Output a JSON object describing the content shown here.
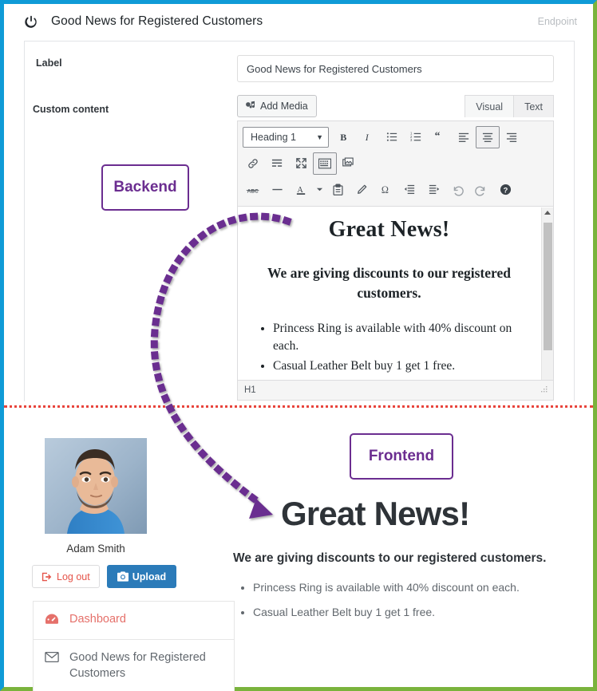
{
  "window": {
    "border_top_left_color": "#0f9bd7",
    "border_bottom_right_color": "#7ab33c",
    "divider_color": "#e8453c"
  },
  "backend": {
    "power_icon": "power-icon",
    "title": "Good News for Registered Customers",
    "endpoint_label": "Endpoint",
    "fields": {
      "label_caption": "Label",
      "label_value": "Good News for Registered Customers",
      "label_placeholder": "Label",
      "content_caption": "Custom content"
    },
    "editor": {
      "add_media_label": "Add Media",
      "add_media_icon": "add-media-icon",
      "tab_visual": "Visual",
      "tab_text": "Text",
      "active_tab": "Text",
      "format_select_value": "Heading 1",
      "format_select_caret": "chevron-down-icon",
      "toolbar_row1": [
        "bold-icon",
        "italic-icon",
        "bulleted-list-icon",
        "numbered-list-icon",
        "blockquote-icon",
        "align-left-icon",
        "align-center-icon",
        "align-right-icon"
      ],
      "toolbar_row2": [
        "link-icon",
        "read-more-icon",
        "fullscreen-icon",
        "toolbar-toggle-icon",
        "gallery-icon"
      ],
      "toolbar_row3": [
        "strikethrough-icon",
        "horizontal-rule-icon",
        "text-color-icon",
        "text-color-caret-icon",
        "paste-as-text-icon",
        "clear-formatting-icon",
        "special-character-icon",
        "outdent-icon",
        "indent-icon",
        "undo-icon",
        "redo-icon",
        "help-icon"
      ],
      "pressed_buttons": [
        "align-center-icon",
        "toolbar-toggle-icon"
      ],
      "content": {
        "heading": "Great News!",
        "subheading": "We are giving discounts to our registered customers.",
        "bullets": [
          "Princess Ring is available with 40% discount on each.",
          "Casual Leather Belt buy 1 get 1 free."
        ]
      },
      "status_path": "H1",
      "resize_handle_icon": "resize-grip-icon",
      "scroll_up_icon": "scroll-up-arrow-icon"
    }
  },
  "frontend": {
    "avatar_alt": "avatar",
    "user_name": "Adam Smith",
    "logout_label": "Log out",
    "logout_icon": "logout-icon",
    "upload_label": "Upload",
    "upload_icon": "camera-icon",
    "menu": [
      {
        "label": "Dashboard",
        "icon": "dashboard-gauge-icon",
        "style": "accent"
      },
      {
        "label": "Good News for Registered Customers",
        "icon": "envelope-icon",
        "style": "plain"
      }
    ],
    "content": {
      "heading": "Great News!",
      "subheading": "We are giving discounts to our registered customers.",
      "bullets": [
        "Princess Ring is available with 40% discount on each.",
        "Casual Leather Belt buy 1 get 1 free."
      ]
    }
  },
  "annotations": {
    "backend_callout": "Backend",
    "frontend_callout": "Frontend",
    "callout_color": "#6b2d90",
    "arrow_color": "#6b2d90"
  }
}
